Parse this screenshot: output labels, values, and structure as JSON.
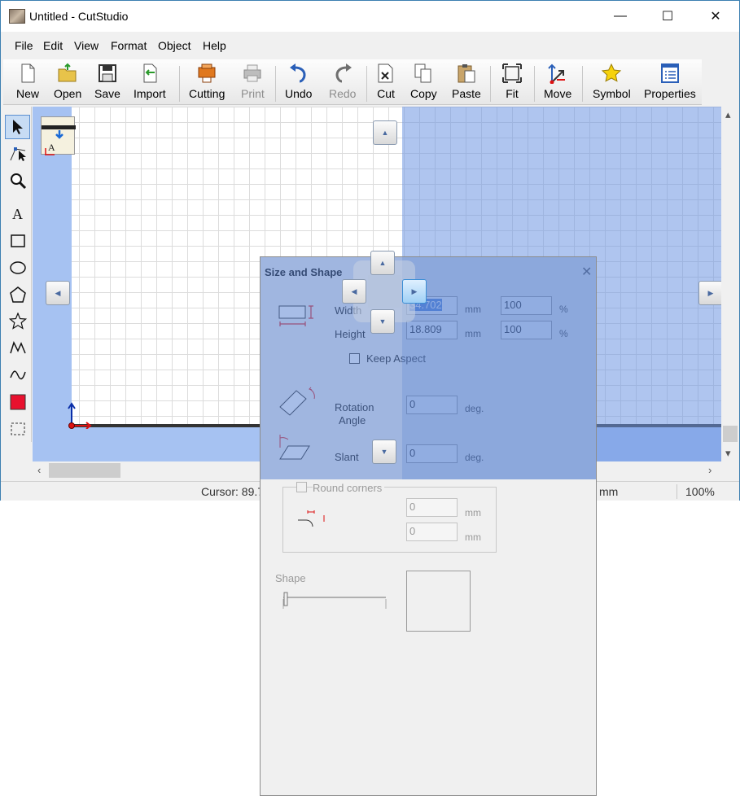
{
  "window": {
    "title": "Untitled - CutStudio",
    "minimize": "—",
    "maximize": "☐",
    "close": "✕"
  },
  "menu": [
    "File",
    "Edit",
    "View",
    "Format",
    "Object",
    "Help"
  ],
  "toolbar": [
    {
      "label": "New",
      "icon": "new-icon",
      "enabled": true
    },
    {
      "label": "Open",
      "icon": "open-icon",
      "enabled": true
    },
    {
      "label": "Save",
      "icon": "save-icon",
      "enabled": true
    },
    {
      "label": "Import",
      "icon": "import-icon",
      "enabled": true
    },
    {
      "label": "Cutting",
      "icon": "cutting-icon",
      "enabled": true
    },
    {
      "label": "Print",
      "icon": "print-icon",
      "enabled": false
    },
    {
      "label": "Undo",
      "icon": "undo-icon",
      "enabled": true
    },
    {
      "label": "Redo",
      "icon": "redo-icon",
      "enabled": false
    },
    {
      "label": "Cut",
      "icon": "cut-icon",
      "enabled": true
    },
    {
      "label": "Copy",
      "icon": "copy-icon",
      "enabled": true
    },
    {
      "label": "Paste",
      "icon": "paste-icon",
      "enabled": true
    },
    {
      "label": "Fit",
      "icon": "fit-icon",
      "enabled": true
    },
    {
      "label": "Move",
      "icon": "move-icon",
      "enabled": true
    },
    {
      "label": "Symbol",
      "icon": "symbol-icon",
      "enabled": true
    },
    {
      "label": "Properties",
      "icon": "properties-icon",
      "enabled": true
    }
  ],
  "left_tools": [
    {
      "icon": "select-arrow-icon",
      "active": true
    },
    {
      "icon": "edit-points-icon",
      "active": false
    },
    {
      "icon": "zoom-icon",
      "active": false
    },
    {
      "icon": "text-tool-icon",
      "active": false
    },
    {
      "icon": "rectangle-tool-icon",
      "active": false
    },
    {
      "icon": "ellipse-tool-icon",
      "active": false
    },
    {
      "icon": "polygon-tool-icon",
      "active": false
    },
    {
      "icon": "star-tool-icon",
      "active": false
    },
    {
      "icon": "polyline-tool-icon",
      "active": false
    },
    {
      "icon": "curve-tool-icon",
      "active": false
    },
    {
      "icon": "fill-color-icon",
      "active": false
    },
    {
      "icon": "marquee-select-icon",
      "active": false
    }
  ],
  "status": {
    "cursor": "Cursor: 89.7",
    "unit": "mm",
    "zoom": "100%"
  },
  "dialog": {
    "title": "Size and Shape",
    "width_label": "Width",
    "width_value": "34.702",
    "width_unit": "mm",
    "width_percent": "100",
    "height_label": "Height",
    "height_value": "18.809",
    "height_unit": "mm",
    "height_percent": "100",
    "percent_sign": "%",
    "keep_aspect": "Keep Aspect",
    "rotation_label_1": "Rotation",
    "rotation_label_2": "Angle",
    "rotation_value": "0",
    "rotation_unit": "deg.",
    "slant_label": "Slant",
    "slant_value": "0",
    "slant_unit": "deg.",
    "round_corners": "Round corners",
    "corner_value_1": "0",
    "corner_value_2": "0",
    "corner_unit": "mm",
    "shape_label": "Shape"
  },
  "colors": {
    "selection": "#6e96e1",
    "fill_color": "#e8102e"
  }
}
